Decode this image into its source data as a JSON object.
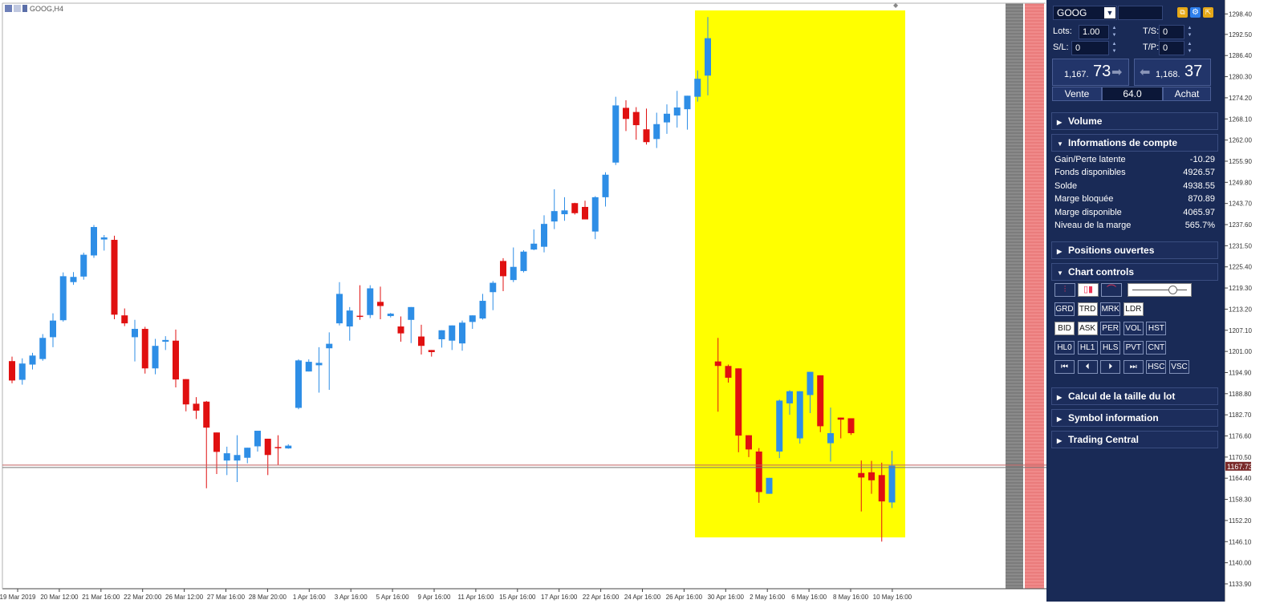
{
  "window": {
    "title": "GOOG,H4"
  },
  "chart_data": {
    "type": "candlestick",
    "symbol": "GOOG,H4",
    "y_axis_ticks": [
      "1298.40",
      "1292.50",
      "1286.40",
      "1280.30",
      "1274.20",
      "1268.10",
      "1262.00",
      "1255.90",
      "1249.80",
      "1243.70",
      "1237.60",
      "1231.50",
      "1225.40",
      "1219.30",
      "1213.20",
      "1207.10",
      "1201.00",
      "1194.90",
      "1188.80",
      "1182.70",
      "1176.60",
      "1170.50",
      "1164.40",
      "1158.30",
      "1152.20",
      "1146.10",
      "1140.00",
      "1133.90"
    ],
    "y_range": [
      1132.5,
      1301.5
    ],
    "x_axis_labels": [
      "19 Mar 2019",
      "20 Mar 12:00",
      "21 Mar 16:00",
      "22 Mar 20:00",
      "26 Mar 12:00",
      "27 Mar 16:00",
      "28 Mar 20:00",
      "1 Apr 16:00",
      "3 Apr 16:00",
      "5 Apr 16:00",
      "9 Apr 16:00",
      "11 Apr 16:00",
      "15 Apr 16:00",
      "17 Apr 16:00",
      "22 Apr 16:00",
      "24 Apr 16:00",
      "26 Apr 16:00",
      "30 Apr 16:00",
      "2 May 16:00",
      "6 May 16:00",
      "8 May 16:00",
      "10 May 16:00"
    ],
    "current_price_label": "1167.73",
    "current_price": 1167.73,
    "ohlc": [
      [
        1198.2,
        1199.5,
        1191.8,
        1192.6
      ],
      [
        1192.8,
        1199.0,
        1191.4,
        1197.5
      ],
      [
        1197.2,
        1200.6,
        1195.8,
        1199.8
      ],
      [
        1198.8,
        1206.0,
        1198.3,
        1204.9
      ],
      [
        1205.1,
        1212.0,
        1202.2,
        1209.9
      ],
      [
        1210.0,
        1223.8,
        1209.6,
        1222.7
      ],
      [
        1221.0,
        1223.9,
        1220.2,
        1222.5
      ],
      [
        1222.6,
        1229.5,
        1221.7,
        1228.9
      ],
      [
        1228.7,
        1237.5,
        1228.0,
        1236.9
      ],
      [
        1233.3,
        1234.6,
        1230.1,
        1233.9
      ],
      [
        1233.2,
        1234.4,
        1210.3,
        1211.6
      ],
      [
        1211.4,
        1213.4,
        1208.3,
        1209.1
      ],
      [
        1205.1,
        1210.1,
        1198.1,
        1207.5
      ],
      [
        1207.5,
        1208.1,
        1194.6,
        1196.1
      ],
      [
        1196.1,
        1204.6,
        1194.4,
        1202.6
      ],
      [
        1203.8,
        1205.4,
        1201.4,
        1204.3
      ],
      [
        1204.1,
        1207.3,
        1190.6,
        1192.9
      ],
      [
        1193.0,
        1192.8,
        1183.7,
        1185.7
      ],
      [
        1185.9,
        1187.8,
        1181.5,
        1183.9
      ],
      [
        1186.5,
        1186.7,
        1161.5,
        1179.0
      ],
      [
        1177.6,
        1175.6,
        1165.6,
        1172.0
      ],
      [
        1169.5,
        1173.5,
        1165.3,
        1171.6
      ],
      [
        1169.5,
        1176.8,
        1163.3,
        1171.1
      ],
      [
        1170.3,
        1171.7,
        1168.7,
        1173.2
      ],
      [
        1173.6,
        1176.8,
        1172.1,
        1178.1
      ],
      [
        1175.8,
        1173.6,
        1165.3,
        1171.1
      ],
      [
        1173.4,
        1176.8,
        1168.3,
        1173.3
      ],
      [
        1173.0,
        1174.2,
        1172.9,
        1173.8
      ],
      [
        1184.7,
        1198.7,
        1184.3,
        1198.4
      ],
      [
        1195.2,
        1198.7,
        1195.2,
        1198.0
      ],
      [
        1197.0,
        1202.2,
        1189.1,
        1197.7
      ],
      [
        1201.9,
        1206.5,
        1189.9,
        1203.2
      ],
      [
        1209.1,
        1221.0,
        1208.5,
        1217.6
      ],
      [
        1208.2,
        1213.8,
        1204.1,
        1212.8
      ],
      [
        1211.3,
        1220.1,
        1210.1,
        1211.1
      ],
      [
        1211.5,
        1220.1,
        1210.6,
        1219.2
      ],
      [
        1215.3,
        1219.7,
        1210.3,
        1214.1
      ],
      [
        1211.2,
        1212.1,
        1210.8,
        1211.9
      ],
      [
        1208.2,
        1211.1,
        1203.8,
        1206.2
      ],
      [
        1210.1,
        1212.1,
        1203.4,
        1213.8
      ],
      [
        1205.3,
        1208.7,
        1200.1,
        1202.6
      ],
      [
        1201.4,
        1201.4,
        1199.5,
        1200.8
      ],
      [
        1204.5,
        1206.4,
        1202.1,
        1207.1
      ],
      [
        1204.1,
        1207.1,
        1201.4,
        1208.5
      ],
      [
        1203.3,
        1209.9,
        1201.2,
        1209.3
      ],
      [
        1209.5,
        1210.7,
        1207.5,
        1211.4
      ],
      [
        1210.5,
        1217.6,
        1210.2,
        1215.6
      ],
      [
        1218.1,
        1221.3,
        1212.9,
        1220.8
      ],
      [
        1227.1,
        1227.9,
        1218.4,
        1222.7
      ],
      [
        1221.6,
        1231.0,
        1221.0,
        1225.4
      ],
      [
        1224.2,
        1230.2,
        1223.8,
        1229.8
      ],
      [
        1230.4,
        1236.2,
        1230.2,
        1232.1
      ],
      [
        1231.2,
        1240.3,
        1229.6,
        1237.8
      ],
      [
        1238.5,
        1247.8,
        1236.3,
        1241.5
      ],
      [
        1240.6,
        1245.5,
        1238.7,
        1241.7
      ],
      [
        1243.8,
        1243.9,
        1240.5,
        1240.9
      ],
      [
        1242.7,
        1244.5,
        1239.6,
        1239.1
      ],
      [
        1235.6,
        1245.8,
        1233.4,
        1245.5
      ],
      [
        1245.5,
        1252.7,
        1242.8,
        1252.0
      ],
      [
        1255.5,
        1274.5,
        1254.8,
        1272.0
      ],
      [
        1271.3,
        1273.5,
        1264.6,
        1268.1
      ],
      [
        1270.1,
        1271.5,
        1262.1,
        1266.3
      ],
      [
        1265.1,
        1271.1,
        1260.7,
        1261.4
      ],
      [
        1262.3,
        1269.9,
        1259.7,
        1266.6
      ],
      [
        1267.1,
        1272.3,
        1263.8,
        1269.6
      ],
      [
        1269.1,
        1276.2,
        1265.6,
        1271.4
      ],
      [
        1270.9,
        1273.4,
        1265.0,
        1274.8
      ],
      [
        1274.5,
        1282.1,
        1273.1,
        1279.7
      ],
      [
        1280.6,
        1297.5,
        1274.9,
        1291.4
      ],
      [
        1198.1,
        1204.9,
        1183.6,
        1196.8
      ],
      [
        1196.8,
        1197.2,
        1192.0,
        1193.4
      ],
      [
        1196.1,
        1191.1,
        1171.9,
        1176.7
      ],
      [
        1176.8,
        1176.4,
        1170.5,
        1172.7
      ],
      [
        1172.1,
        1173.1,
        1157.3,
        1160.4
      ],
      [
        1159.9,
        1163.8,
        1160.0,
        1164.5
      ],
      [
        1172.1,
        1187.1,
        1170.2,
        1186.8
      ],
      [
        1186.0,
        1189.8,
        1182.7,
        1189.5
      ],
      [
        1175.9,
        1188.5,
        1174.4,
        1189.5
      ],
      [
        1188.4,
        1193.4,
        1183.2,
        1195.1
      ],
      [
        1194.1,
        1193.4,
        1177.7,
        1179.4
      ],
      [
        1174.5,
        1184.8,
        1169.2,
        1177.4
      ],
      [
        1181.9,
        1181.7,
        1175.9,
        1181.3
      ],
      [
        1181.7,
        1181.7,
        1176.9,
        1177.4
      ],
      [
        1165.9,
        1169.5,
        1154.8,
        1164.6
      ],
      [
        1166.1,
        1169.4,
        1159.9,
        1163.8
      ],
      [
        1165.3,
        1168.9,
        1146.1,
        1157.7
      ],
      [
        1157.4,
        1172.3,
        1155.8,
        1168.0
      ]
    ]
  },
  "trade_panel": {
    "symbol": "GOOG",
    "lots_label": "Lots:",
    "lots_value": "1.00",
    "ts_label": "T/S:",
    "ts_value": "0",
    "sl_label": "S/L:",
    "sl_value": "0",
    "tp_label": "T/P:",
    "tp_value": "0",
    "sell_price_small": "1,167.",
    "sell_price_big": "73",
    "buy_price_small": "1,168.",
    "buy_price_big": "37",
    "sell_label": "Vente",
    "buy_label": "Achat",
    "spread": "64.0"
  },
  "sections": {
    "volume": "Volume",
    "account_info": "Informations de compte",
    "open_positions": "Positions ouvertes",
    "chart_controls": "Chart controls",
    "lot_size_calc": "Calcul de la taille du lot",
    "symbol_info": "Symbol information",
    "trading_central": "Trading Central"
  },
  "account": [
    {
      "label": "Gain/Perte latente",
      "value": "-10.29"
    },
    {
      "label": "Fonds disponibles",
      "value": "4926.57"
    },
    {
      "label": "Solde",
      "value": "4938.55"
    },
    {
      "label": "Marge bloquée",
      "value": "870.89"
    },
    {
      "label": "Marge disponible",
      "value": "4065.97"
    },
    {
      "label": "Niveau de la marge",
      "value": "565.7%"
    }
  ],
  "chart_controls": {
    "row1": [
      "GRD",
      "TRD",
      "MRK",
      "LDR"
    ],
    "row2": [
      "BID",
      "ASK",
      "PER",
      "VOL",
      "HST"
    ],
    "row3": [
      "HL0",
      "HL1",
      "HLS",
      "PVT",
      "CNT"
    ],
    "row4": [
      "⏮",
      "⏴",
      "⏵",
      "⏭",
      "HSC",
      "VSC"
    ],
    "active": [
      "TRD",
      "LDR",
      "BID",
      "ASK"
    ],
    "zoom_level": 0.78
  }
}
